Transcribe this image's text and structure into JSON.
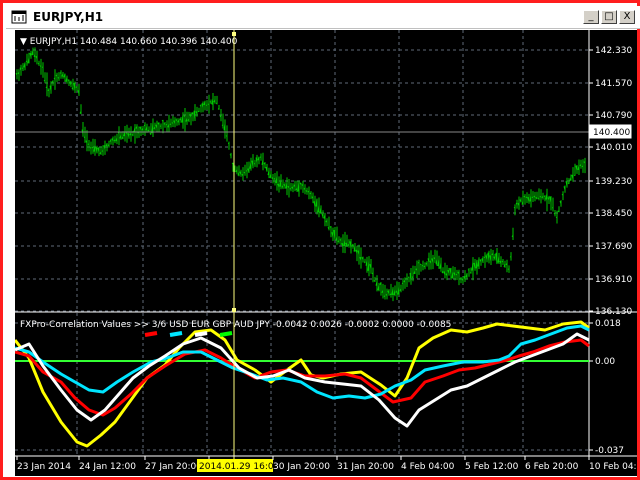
{
  "window": {
    "title": "EURJPY,H1",
    "buttons": {
      "minimize": "_",
      "maximize": "□",
      "close": "X"
    }
  },
  "main_chart": {
    "header": "▼ EURJPY,H1  140.484 140.660 140.396 140.400",
    "price_labels": [
      "142.330",
      "141.570",
      "140.790",
      "140.400",
      "140.010",
      "139.230",
      "138.450",
      "137.690",
      "136.910",
      "136.130"
    ],
    "current_price": "140.400",
    "colors": {
      "bars": "#00c800",
      "grid": "#5f6a78",
      "axis_text": "#ffffff",
      "crosshair": "#ffff80"
    }
  },
  "indicator": {
    "header": "FXPro-Correlation  Values >> 3/6 USD EUR GBP AUD JPY -0.0042 0.0026 -0.0002 0.0000 -0.0085",
    "scale_labels": [
      "0.018",
      "0.00",
      "-0.037"
    ],
    "legend_swatches": [
      {
        "name": "red-swatch",
        "color": "#ff0000"
      },
      {
        "name": "cyan-swatch",
        "color": "#00e5ff"
      },
      {
        "name": "white-swatch",
        "color": "#ffffff"
      },
      {
        "name": "green-swatch",
        "color": "#00ff00"
      }
    ],
    "colors": {
      "zero_line": "#33ff33",
      "yellow": "#ffff00",
      "red": "#ff0000",
      "cyan": "#00e5ff",
      "white": "#ffffff"
    }
  },
  "time_axis": {
    "labels": [
      "23 Jan 2014",
      "24 Jan 12:00",
      "27 Jan 20:00",
      "2014.01.29 16:00",
      "30 Jan 20:00",
      "31 Jan 20:00",
      "4 Feb 04:00",
      "5 Feb 12:00",
      "6 Feb 20:00",
      "10 Feb 04:00"
    ],
    "highlighted": "2014.01.29 16:00"
  }
}
